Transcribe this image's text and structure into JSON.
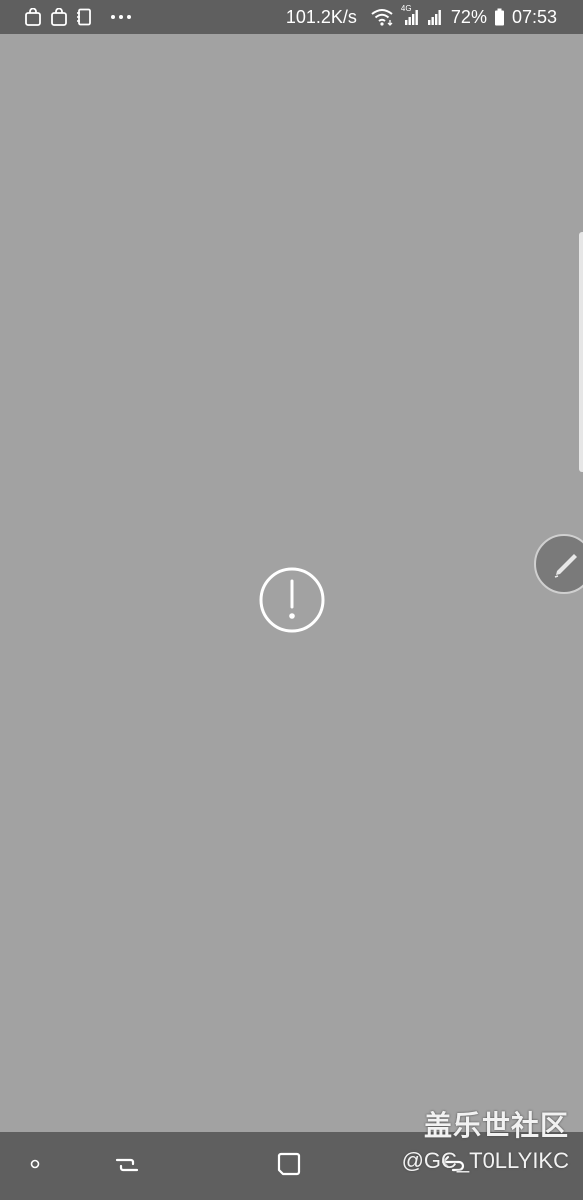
{
  "status_bar": {
    "network_speed": "101.2K/s",
    "signal_label": "4G",
    "battery_percent": "72%",
    "time": "07:53",
    "notification_icons": [
      "bag-icon",
      "bag-icon",
      "notebook-icon",
      "more-dots-icon"
    ],
    "system_icons": [
      "wifi-icon",
      "signal-4g-icon",
      "signal-icon",
      "battery-icon"
    ]
  },
  "content": {
    "state_icon": "error-exclamation-icon",
    "floating_button_icon": "pen-icon"
  },
  "nav_bar": {
    "buttons": [
      "home-dot-icon",
      "recent-apps-icon",
      "home-square-icon",
      "back-icon"
    ]
  },
  "watermark": {
    "title": "盖乐世社区",
    "handle": "@GC_T0LLYIKC"
  },
  "colors": {
    "background": "#a2a2a2",
    "bars": "#5f5f5f",
    "foreground": "#ffffff"
  }
}
